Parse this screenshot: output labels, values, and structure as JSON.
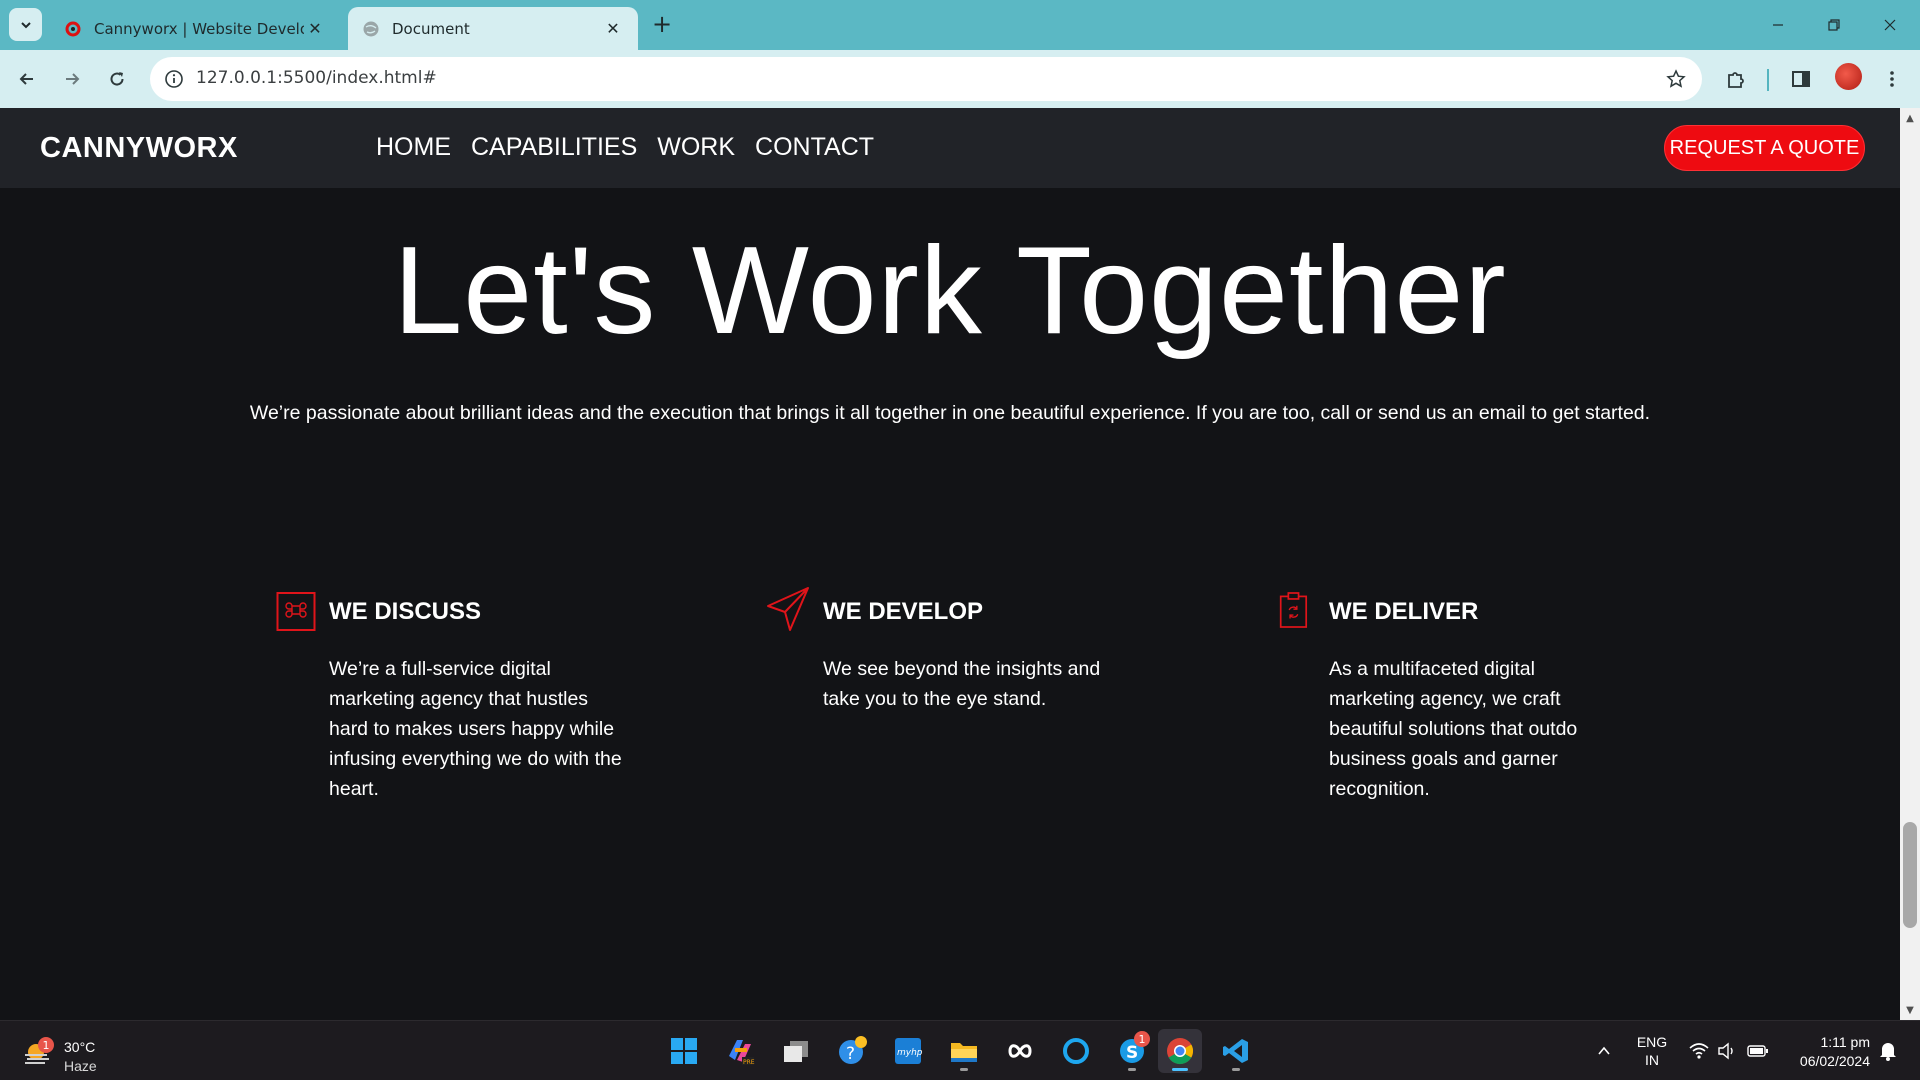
{
  "browser": {
    "tabs": [
      {
        "title": "Cannyworx | Website Developm",
        "active": false,
        "favicon": "cannyworx-favicon-icon"
      },
      {
        "title": "Document",
        "active": true,
        "favicon": "globe-icon"
      }
    ],
    "url": "127.0.0.1:5500/index.html#"
  },
  "site": {
    "brand": "CANNYWORX",
    "nav": [
      "HOME",
      "CAPABILITIES",
      "WORK",
      "CONTACT"
    ],
    "cta": "REQUEST A QUOTE",
    "hero_title": "Let's Work Together",
    "hero_text": "We’re passionate about brilliant ideas and the execution that brings it all together in one beautiful experience. If you are too, call or send us an email to get started.",
    "features": [
      {
        "title": "WE DISCUSS",
        "icon": "command-icon",
        "text": "We’re a full-service digital marketing agency that hustles hard to makes users happy while infusing everything we do with the heart."
      },
      {
        "title": "WE DEVELOP",
        "icon": "paper-plane-icon",
        "text": "We see beyond the insights and take you to the eye stand."
      },
      {
        "title": "WE DELIVER",
        "icon": "clipboard-refresh-icon",
        "text": "As a multifaceted digital marketing agency, we craft beautiful solutions that outdo business goals and garner recognition."
      }
    ],
    "colors": {
      "accent": "#ee0b11",
      "background": "#121316",
      "navbar": "#212328"
    }
  },
  "taskbar": {
    "weather": {
      "temp": "30°C",
      "condition": "Haze",
      "badge": "1"
    },
    "apps": [
      {
        "name": "start-icon",
        "badge": ""
      },
      {
        "name": "copilot-icon",
        "badge": ""
      },
      {
        "name": "task-view-icon",
        "badge": ""
      },
      {
        "name": "get-help-icon",
        "badge": ""
      },
      {
        "name": "myhp-icon",
        "badge": ""
      },
      {
        "name": "file-explorer-icon",
        "badge": ""
      },
      {
        "name": "meta-infinity-icon",
        "badge": ""
      },
      {
        "name": "cortana-ring-icon",
        "badge": ""
      },
      {
        "name": "skype-icon",
        "badge": "1"
      },
      {
        "name": "chrome-icon",
        "badge": ""
      },
      {
        "name": "vscode-icon",
        "badge": ""
      }
    ],
    "lang": "ENG",
    "region": "IN",
    "time": "1:11 pm",
    "date": "06/02/2024"
  }
}
